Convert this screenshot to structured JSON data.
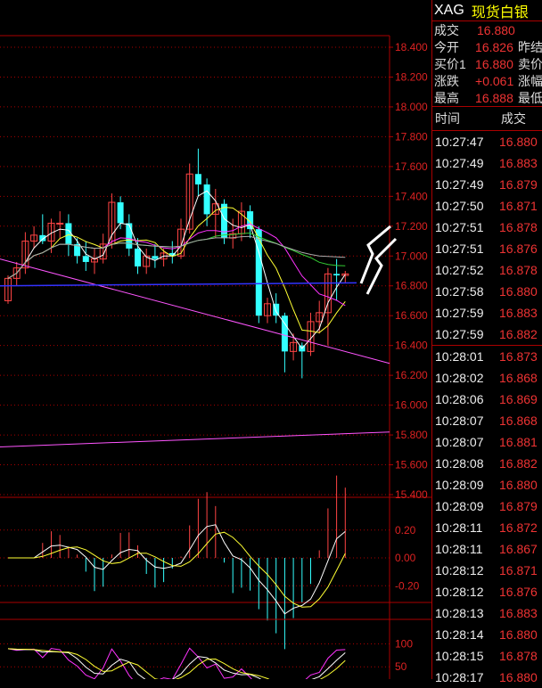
{
  "header": {
    "symbol": "XAG",
    "name": "现货白银"
  },
  "quote": [
    {
      "label": "成交",
      "value": "16.880",
      "label2": ""
    },
    {
      "label": "今开",
      "value": "16.826",
      "label2": "昨结"
    },
    {
      "label": "买价1",
      "value": "16.880",
      "label2": "卖价"
    },
    {
      "label": "涨跌",
      "value": "+0.061",
      "label2": "涨幅"
    },
    {
      "label": "最高",
      "value": "16.888",
      "label2": "最低"
    }
  ],
  "ticks_header": {
    "time": "时间",
    "price": "成交"
  },
  "ticks": [
    {
      "t": "10:27:47",
      "p": "16.880"
    },
    {
      "t": "10:27:49",
      "p": "16.883"
    },
    {
      "t": "10:27:49",
      "p": "16.879"
    },
    {
      "t": "10:27:50",
      "p": "16.871"
    },
    {
      "t": "10:27:51",
      "p": "16.878"
    },
    {
      "t": "10:27:51",
      "p": "16.876"
    },
    {
      "t": "10:27:52",
      "p": "16.878"
    },
    {
      "t": "10:27:58",
      "p": "16.880"
    },
    {
      "t": "10:27:59",
      "p": "16.883"
    },
    {
      "t": "10:27:59",
      "p": "16.882"
    },
    {
      "t": "10:28:01",
      "p": "16.873"
    },
    {
      "t": "10:28:02",
      "p": "16.868"
    },
    {
      "t": "10:28:06",
      "p": "16.869"
    },
    {
      "t": "10:28:07",
      "p": "16.868"
    },
    {
      "t": "10:28:07",
      "p": "16.881"
    },
    {
      "t": "10:28:08",
      "p": "16.882"
    },
    {
      "t": "10:28:09",
      "p": "16.880"
    },
    {
      "t": "10:28:09",
      "p": "16.879"
    },
    {
      "t": "10:28:11",
      "p": "16.872"
    },
    {
      "t": "10:28:11",
      "p": "16.867"
    },
    {
      "t": "10:28:12",
      "p": "16.871"
    },
    {
      "t": "10:28:12",
      "p": "16.876"
    },
    {
      "t": "10:28:13",
      "p": "16.883"
    },
    {
      "t": "10:28:14",
      "p": "16.880"
    },
    {
      "t": "10:28:15",
      "p": "16.878"
    },
    {
      "t": "10:28:17",
      "p": "16.880"
    }
  ],
  "chart_data": [
    {
      "type": "candlestick",
      "yticks": [
        "18.400",
        "18.200",
        "18.000",
        "17.800",
        "17.600",
        "17.400",
        "17.200",
        "17.000",
        "16.800",
        "16.600",
        "16.400",
        "16.200",
        "16.000",
        "15.800",
        "15.600",
        "15.400"
      ],
      "ylim": [
        15.4,
        18.4
      ],
      "grid": true,
      "candles": [
        {
          "o": 16.7,
          "h": 16.87,
          "l": 16.68,
          "c": 16.85
        },
        {
          "o": 16.85,
          "h": 16.96,
          "l": 16.8,
          "c": 16.92
        },
        {
          "o": 16.92,
          "h": 17.16,
          "l": 16.88,
          "c": 17.1
        },
        {
          "o": 17.1,
          "h": 17.2,
          "l": 17.05,
          "c": 17.14
        },
        {
          "o": 17.14,
          "h": 17.28,
          "l": 17.08,
          "c": 17.1
        },
        {
          "o": 17.1,
          "h": 17.25,
          "l": 17.02,
          "c": 17.22
        },
        {
          "o": 17.22,
          "h": 17.3,
          "l": 17.12,
          "c": 17.22
        },
        {
          "o": 17.22,
          "h": 17.28,
          "l": 17.0,
          "c": 17.08
        },
        {
          "o": 17.08,
          "h": 17.12,
          "l": 16.95,
          "c": 17.0
        },
        {
          "o": 17.0,
          "h": 17.1,
          "l": 16.9,
          "c": 16.96
        },
        {
          "o": 16.96,
          "h": 17.05,
          "l": 16.88,
          "c": 16.98
        },
        {
          "o": 16.98,
          "h": 17.15,
          "l": 16.95,
          "c": 17.08
        },
        {
          "o": 17.08,
          "h": 17.42,
          "l": 17.05,
          "c": 17.36
        },
        {
          "o": 17.36,
          "h": 17.4,
          "l": 17.18,
          "c": 17.22
        },
        {
          "o": 17.22,
          "h": 17.28,
          "l": 17.0,
          "c": 17.05
        },
        {
          "o": 17.05,
          "h": 17.12,
          "l": 16.88,
          "c": 16.93
        },
        {
          "o": 16.93,
          "h": 17.05,
          "l": 16.88,
          "c": 17.0
        },
        {
          "o": 17.0,
          "h": 17.08,
          "l": 16.92,
          "c": 16.98
        },
        {
          "o": 16.98,
          "h": 17.05,
          "l": 16.93,
          "c": 17.02
        },
        {
          "o": 17.02,
          "h": 17.1,
          "l": 16.95,
          "c": 17.0
        },
        {
          "o": 17.0,
          "h": 17.25,
          "l": 16.98,
          "c": 17.18
        },
        {
          "o": 17.18,
          "h": 17.62,
          "l": 17.15,
          "c": 17.55
        },
        {
          "o": 17.55,
          "h": 17.72,
          "l": 17.4,
          "c": 17.48
        },
        {
          "o": 17.48,
          "h": 17.52,
          "l": 17.2,
          "c": 17.28
        },
        {
          "o": 17.28,
          "h": 17.45,
          "l": 17.12,
          "c": 17.35
        },
        {
          "o": 17.35,
          "h": 17.38,
          "l": 17.08,
          "c": 17.12
        },
        {
          "o": 17.12,
          "h": 17.25,
          "l": 17.05,
          "c": 17.15
        },
        {
          "o": 17.15,
          "h": 17.36,
          "l": 17.1,
          "c": 17.3
        },
        {
          "o": 17.3,
          "h": 17.34,
          "l": 17.12,
          "c": 17.18
        },
        {
          "o": 17.18,
          "h": 17.2,
          "l": 16.55,
          "c": 16.6
        },
        {
          "o": 16.6,
          "h": 16.72,
          "l": 16.55,
          "c": 16.68
        },
        {
          "o": 16.68,
          "h": 16.75,
          "l": 16.55,
          "c": 16.6
        },
        {
          "o": 16.6,
          "h": 16.62,
          "l": 16.22,
          "c": 16.36
        },
        {
          "o": 16.36,
          "h": 16.48,
          "l": 16.3,
          "c": 16.42
        },
        {
          "o": 16.4,
          "h": 16.42,
          "l": 16.18,
          "c": 16.36
        },
        {
          "o": 16.36,
          "h": 16.62,
          "l": 16.33,
          "c": 16.56
        },
        {
          "o": 16.56,
          "h": 16.7,
          "l": 16.48,
          "c": 16.62
        },
        {
          "o": 16.62,
          "h": 16.92,
          "l": 16.4,
          "c": 16.88
        },
        {
          "o": 16.88,
          "h": 16.98,
          "l": 16.7,
          "c": 16.87
        },
        {
          "o": 16.87,
          "h": 16.9,
          "l": 16.82,
          "c": 16.88
        }
      ]
    },
    {
      "type": "bar",
      "yticks": [
        "0.20",
        "0.00",
        "-0.20"
      ],
      "ylim": [
        -0.32,
        0.32
      ]
    },
    {
      "type": "line",
      "yticks": [
        "100",
        "50"
      ],
      "ylim": [
        0,
        130
      ]
    }
  ],
  "colors": {
    "up": "#ff4444",
    "down": "#33ffff",
    "grid": "#aa0000",
    "axis_text": "#dd2222",
    "price": "#ee3333"
  }
}
